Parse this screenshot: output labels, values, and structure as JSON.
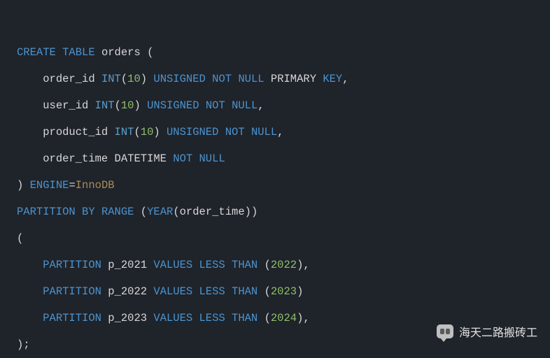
{
  "code": {
    "line1": {
      "kw_create": "CREATE",
      "kw_table": "TABLE",
      "ident": "orders",
      "paren": "("
    },
    "line2": {
      "indent": "    ",
      "col": "order_id",
      "type": "INT",
      "paren_o": "(",
      "size": "10",
      "paren_c": ")",
      "kw_unsigned": "UNSIGNED",
      "kw_not": "NOT",
      "kw_null": "NULL",
      "kw_primary": "PRIMARY",
      "kw_key": "KEY",
      "comma": ","
    },
    "line3": {
      "indent": "    ",
      "col": "user_id",
      "type": "INT",
      "paren_o": "(",
      "size": "10",
      "paren_c": ")",
      "kw_unsigned": "UNSIGNED",
      "kw_not": "NOT",
      "kw_null": "NULL",
      "comma": ","
    },
    "line4": {
      "indent": "    ",
      "col": "product_id",
      "type": "INT",
      "paren_o": "(",
      "size": "10",
      "paren_c": ")",
      "kw_unsigned": "UNSIGNED",
      "kw_not": "NOT",
      "kw_null": "NULL",
      "comma": ","
    },
    "line5": {
      "indent": "    ",
      "col": "order_time",
      "type": "DATETIME",
      "kw_not": "NOT",
      "kw_null": "NULL"
    },
    "line6": {
      "paren_c": ")",
      "kw_engine": "ENGINE",
      "eq": "=",
      "engine_val": "InnoDB"
    },
    "line7": {
      "kw_partition": "PARTITION",
      "kw_by": "BY",
      "kw_range": "RANGE",
      "paren_o": "(",
      "func": "YEAR",
      "fparen_o": "(",
      "arg": "order_time",
      "fparen_c": ")",
      "paren_c": ")"
    },
    "line8": {
      "paren_o": "("
    },
    "line9": {
      "indent": "    ",
      "kw_partition": "PARTITION",
      "name": "p_2021",
      "kw_values": "VALUES",
      "kw_less": "LESS",
      "kw_than": "THAN",
      "paren_o": "(",
      "val": "2022",
      "paren_c": ")",
      "comma": ","
    },
    "line10": {
      "indent": "    ",
      "kw_partition": "PARTITION",
      "name": "p_2022",
      "kw_values": "VALUES",
      "kw_less": "LESS",
      "kw_than": "THAN",
      "paren_o": "(",
      "val": "2023",
      "paren_c": ")"
    },
    "line11": {
      "indent": "    ",
      "kw_partition": "PARTITION",
      "name": "p_2023",
      "kw_values": "VALUES",
      "kw_less": "LESS",
      "kw_than": "THAN",
      "paren_o": "(",
      "val": "2024",
      "paren_c": ")",
      "comma": ","
    },
    "line12": {
      "paren_c": ")",
      "semi": ";"
    }
  },
  "watermark": {
    "text": "海天二路搬砖工"
  }
}
